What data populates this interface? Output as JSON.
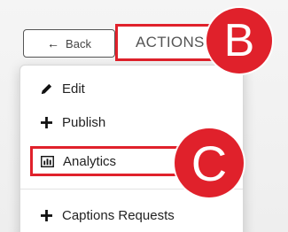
{
  "colors": {
    "highlight": "#e0212b",
    "marker": "#e0212b"
  },
  "back_button": {
    "icon": "arrow-left-icon",
    "label": "Back"
  },
  "actions_button": {
    "label": "ACTIONS"
  },
  "markers": {
    "b": "B",
    "c": "C"
  },
  "menu": {
    "items": [
      {
        "icon": "pencil-icon",
        "label": "Edit"
      },
      {
        "icon": "plus-icon",
        "label": "Publish"
      },
      {
        "icon": "bar-chart-icon",
        "label": "Analytics",
        "highlighted": true
      },
      {
        "icon": "plus-icon",
        "label": "Captions Requests"
      }
    ]
  }
}
